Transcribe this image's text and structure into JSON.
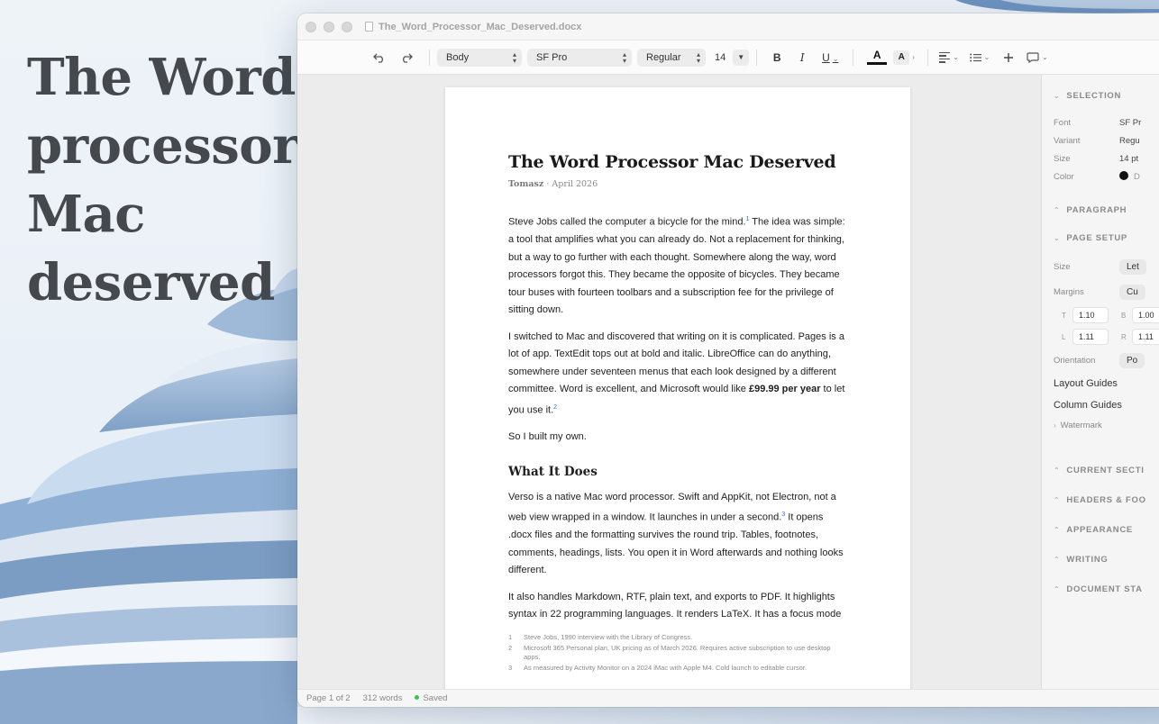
{
  "hero": {
    "line1": "The Word",
    "line2": "processor",
    "line3": "Mac",
    "line4": "deserved"
  },
  "window": {
    "title": "The_Word_Processor_Mac_Deserved.docx"
  },
  "toolbar": {
    "style_value": "Body",
    "font_value": "SF Pro",
    "weight_value": "Regular",
    "size_value": "14",
    "bold_label": "B",
    "italic_label": "I",
    "underline_label": "U",
    "color_label": "A",
    "highlight_label": "A",
    "icons": [
      "undo-icon",
      "redo-icon",
      "align-left-icon",
      "list-icon",
      "plus-icon",
      "comment-icon"
    ]
  },
  "document": {
    "title": "The Word Processor Mac Deserved",
    "author": "Tomasz",
    "date": "April 2026",
    "meta_sep": "·",
    "p1": "Steve Jobs called the computer a bicycle for the mind.",
    "p1_fn": "1",
    "p1b": " The idea was simple: a tool that amplifies what you can already do. Not a replacement for thinking, but a way to go further with each thought. Somewhere along the way, word processors forgot this. They became the opposite of bicycles. They became tour buses with fourteen toolbars and a subscription fee for the privilege of sitting down.",
    "p2a": "I switched to Mac and discovered that writing on it is complicated. Pages is a lot of app. TextEdit tops out at bold and italic. LibreOffice can do anything, somewhere under seventeen menus that each look designed by a different committee. Word is excellent, and Microsoft would like ",
    "p2_bold": "£99.99 per year",
    "p2b": " to let you use it.",
    "p2_fn": "2",
    "p3": "So I built my own.",
    "h2": "What It Does",
    "p4a": "Verso is a native Mac word processor. Swift and AppKit, not Electron, not a web view wrapped in a window. It launches in under a second.",
    "p4_fn": "3",
    "p4b": " It opens .docx files and the formatting survives the round trip. Tables, footnotes, comments, headings, lists. You open it in Word afterwards and nothing looks different.",
    "p5": "It also handles Markdown, RTF, plain text, and exports to PDF. It highlights syntax in 22 programming languages. It renders LaTeX. It has a focus mode",
    "footnotes": [
      {
        "n": "1",
        "text": "Steve Jobs, 1990 interview with the Library of Congress."
      },
      {
        "n": "2",
        "text": "Microsoft 365 Personal plan, UK pricing as of March 2026. Requires active subscription to use desktop apps."
      },
      {
        "n": "3",
        "text": "As measured by Activity Monitor on a 2024 iMac with Apple M4. Cold launch to editable cursor."
      }
    ]
  },
  "sidebar": {
    "selection_header": "SELECTION",
    "font_label": "Font",
    "font_value": "SF Pr",
    "variant_label": "Variant",
    "variant_value": "Regu",
    "size_label": "Size",
    "size_value": "14 pt",
    "color_label": "Color",
    "color_value": "D",
    "paragraph_header": "PARAGRAPH",
    "page_setup_header": "PAGE SETUP",
    "ps_size_label": "Size",
    "ps_size_value": "Let",
    "margins_label": "Margins",
    "margins_value": "Cu",
    "margin_t_label": "T",
    "margin_t": "1.10",
    "margin_b_label": "B",
    "margin_b": "1.00",
    "margin_l_label": "L",
    "margin_l": "1.11",
    "margin_r_label": "R",
    "margin_r": "1.11",
    "orientation_label": "Orientation",
    "orientation_value": "Po",
    "layout_guides": "Layout Guides",
    "column_guides": "Column Guides",
    "watermark": "Watermark",
    "current_section_header": "CURRENT SECTI",
    "headers_header": "HEADERS & FOO",
    "appearance_header": "APPEARANCE",
    "writing_header": "WRITING",
    "doc_stats_header": "DOCUMENT STA"
  },
  "status": {
    "page": "Page 1 of 2",
    "words": "312 words",
    "saved": "Saved"
  },
  "colors": {
    "accent": "#2f6bd8",
    "saved": "#40c057",
    "hero_text": "#45494e"
  }
}
